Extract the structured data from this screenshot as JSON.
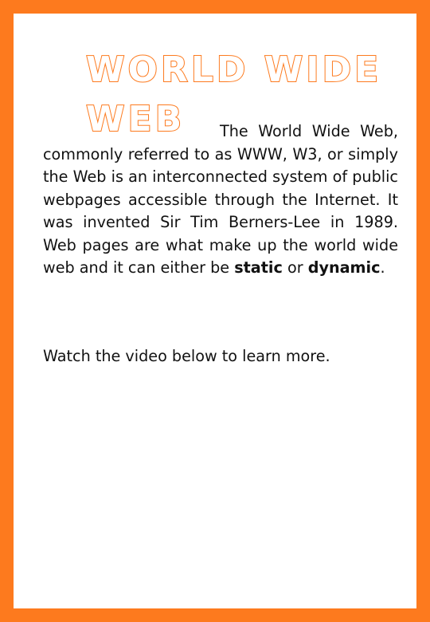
{
  "heading": "WORLD WIDE WEB",
  "intro": {
    "text_before": "The World Wide Web, commonly referred to as WWW, W3, or simply the Web is an interconnected system of public webpages accessible through the Internet. It was invented Sir Tim Berners-Lee in 1989. Web pages are what make up the world wide web and it can either be ",
    "bold_1": "static",
    "middle": " or ",
    "bold_2": "dynamic",
    "end": "."
  },
  "note": "Watch the video below to learn more.",
  "colors": {
    "border": "#fd7a1e",
    "heading_outline": "#fd7a1e",
    "background": "#ffffff",
    "text": "#111111"
  }
}
